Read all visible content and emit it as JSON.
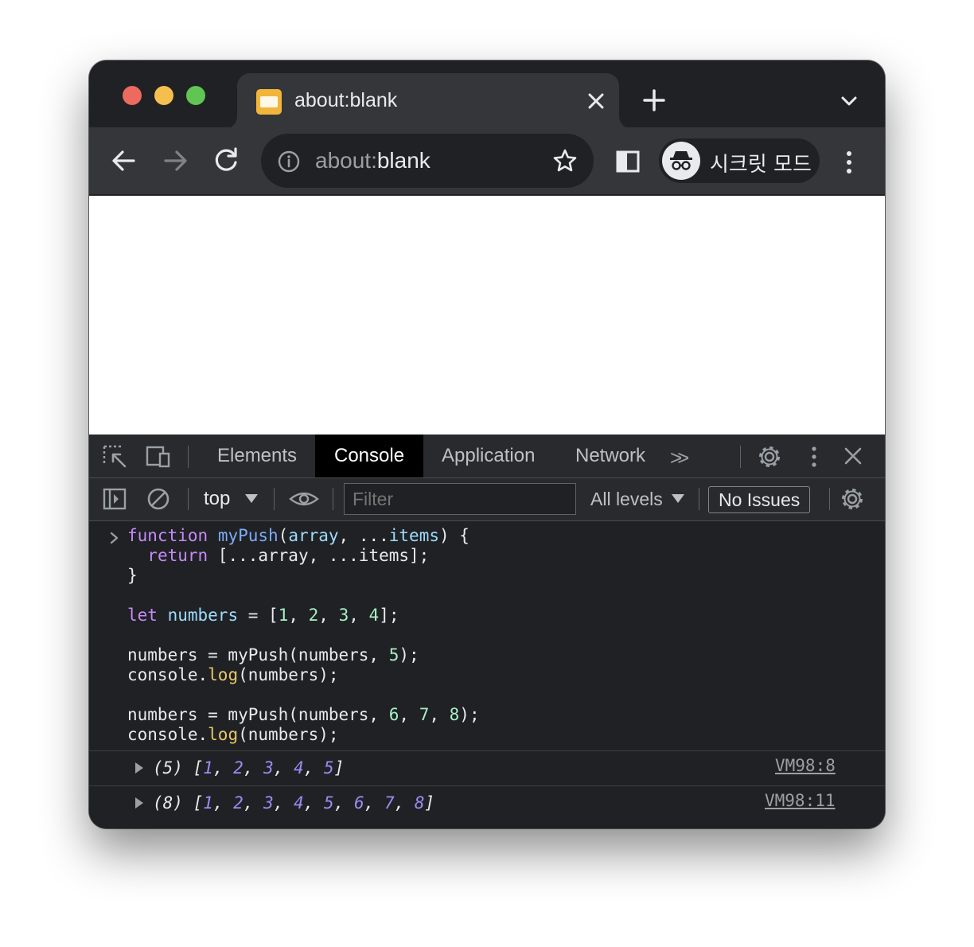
{
  "tab": {
    "title": "about:blank",
    "close_label": "×"
  },
  "omnibox": {
    "scheme": "about:",
    "host": "blank"
  },
  "profile": {
    "label": "시크릿 모드"
  },
  "devtools": {
    "tabs": [
      "Elements",
      "Console",
      "Application",
      "Network"
    ],
    "active_tab": "Console",
    "overflow": ">>",
    "context": "top",
    "filter_placeholder": "Filter",
    "levels": "All levels",
    "issues": "No Issues"
  },
  "console": {
    "code_lines": [
      "function myPush(array, ...items) {",
      "  return [...array, ...items];",
      "}",
      "",
      "let numbers = [1, 2, 3, 4];",
      "",
      "numbers = myPush(numbers, 5);",
      "console.log(numbers);",
      "",
      "numbers = myPush(numbers, 6, 7, 8);",
      "console.log(numbers);"
    ],
    "outputs": [
      {
        "count": "(5)",
        "values": [
          1,
          2,
          3,
          4,
          5
        ],
        "source": "VM98:8"
      },
      {
        "count": "(8)",
        "values": [
          1,
          2,
          3,
          4,
          5,
          6,
          7,
          8
        ],
        "source": "VM98:11"
      }
    ]
  },
  "colors": {
    "window_bg": "#202124",
    "toolbar_bg": "#35363a",
    "keyword": "#c58af9",
    "function": "#7cacf8",
    "number": "#a8f0c6",
    "method": "#e8c76a",
    "output_number": "#9a8cf5"
  }
}
